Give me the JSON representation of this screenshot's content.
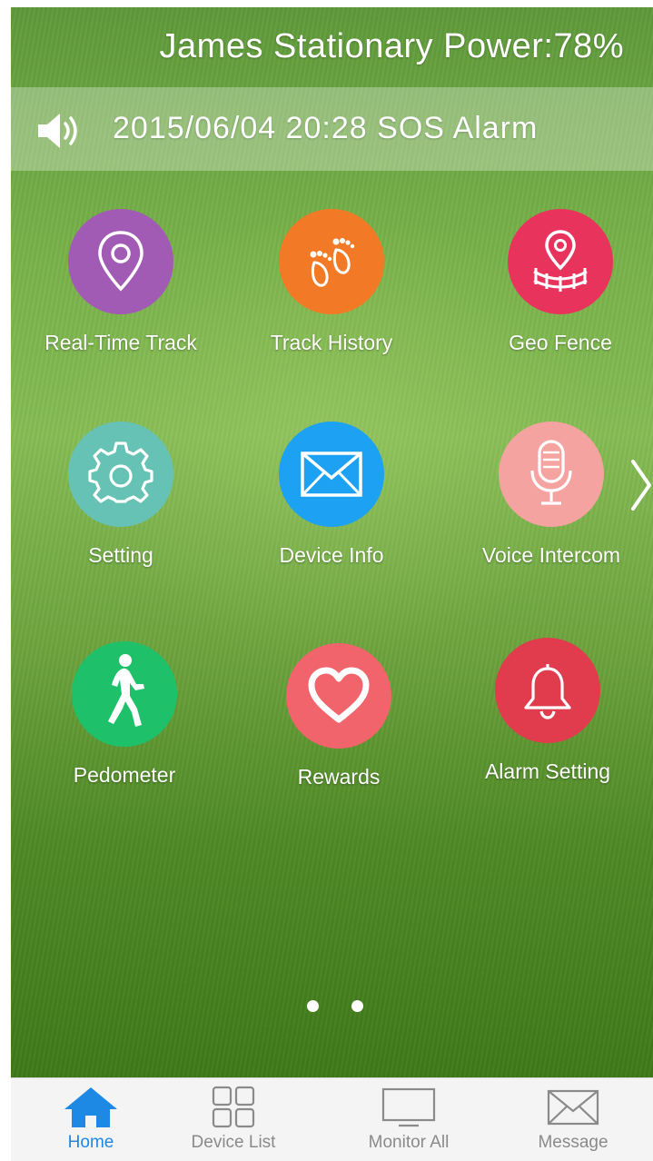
{
  "header": {
    "title": "James Stationary Power:78%"
  },
  "alarm": {
    "text": "2015/06/04  20:28 SOS Alarm",
    "icon": "speaker-icon"
  },
  "grid": {
    "items": [
      {
        "label": "Real-Time Track",
        "icon": "location-pin-icon",
        "color": "#a25bb5"
      },
      {
        "label": "Track History",
        "icon": "footprints-icon",
        "color": "#f27a26"
      },
      {
        "label": "Geo Fence",
        "icon": "geo-fence-icon",
        "color": "#e8345c"
      },
      {
        "label": "Setting",
        "icon": "gear-icon",
        "color": "#66c2b4"
      },
      {
        "label": "Device Info",
        "icon": "envelope-icon",
        "color": "#1da1f2"
      },
      {
        "label": "Voice Intercom",
        "icon": "microphone-icon",
        "color": "#f5a3a0"
      },
      {
        "label": "Pedometer",
        "icon": "runner-icon",
        "color": "#1fc06a"
      },
      {
        "label": "Rewards",
        "icon": "heart-icon",
        "color": "#f2646b"
      },
      {
        "label": "Alarm Setting",
        "icon": "bell-icon",
        "color": "#e03c4e"
      }
    ]
  },
  "pager": {
    "pages": 2
  },
  "tabs": [
    {
      "label": "Home",
      "icon": "home-icon",
      "active": true,
      "active_color": "#1e88e5"
    },
    {
      "label": "Device List",
      "icon": "grid-icon",
      "active": false
    },
    {
      "label": "Monitor All",
      "icon": "monitor-icon",
      "active": false
    },
    {
      "label": "Message",
      "icon": "envelope-icon",
      "active": false
    }
  ]
}
